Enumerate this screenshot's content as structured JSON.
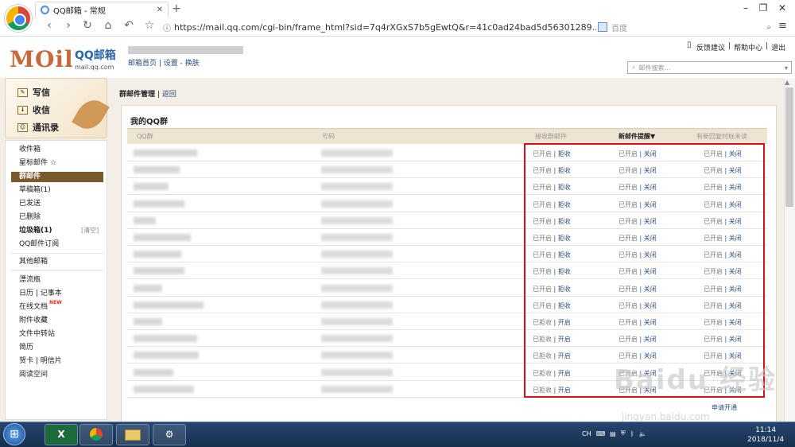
{
  "browser": {
    "tab_title": "QQ邮箱 - 常规",
    "new_tab": "+",
    "url": "https://mail.qq.com/cgi-bin/frame_html?sid=7q4rXGxS7b5gEwtQ&r=41c0ad24bad5d56301289...",
    "search_placeholder": "百度",
    "window_controls": [
      "–",
      "❐",
      "✕"
    ]
  },
  "header": {
    "logo_mark": "MOil",
    "logo_name": "QQ邮箱",
    "logo_domain": "mail.qq.com",
    "links": "邮箱首页 | 设置 - 换肤",
    "top_links": [
      "反馈建议",
      "|",
      "帮助中心",
      "|",
      "退出"
    ],
    "search_placeholder": "邮件搜索..."
  },
  "sidebar": {
    "actions": [
      "写信",
      "收信",
      "通讯录"
    ],
    "items": [
      {
        "label": "收件箱"
      },
      {
        "label": "星标邮件 ☆"
      },
      {
        "label": "群邮件"
      },
      {
        "label": "草稿箱(1)"
      },
      {
        "label": "已发送"
      },
      {
        "label": "已删除"
      },
      {
        "label": "垃圾箱(1)"
      },
      {
        "label": "QQ邮件订阅"
      },
      {
        "label": "其他邮箱"
      },
      {
        "label": "漂流瓶"
      },
      {
        "label": "日历 | 记事本"
      },
      {
        "label": "在线文档"
      },
      {
        "label": "附件收藏"
      },
      {
        "label": "文件中转站"
      },
      {
        "label": "简历"
      },
      {
        "label": "贺卡 | 明信片"
      },
      {
        "label": "阅读空间"
      }
    ],
    "trash_clear": "[清空]",
    "new_badge": "NEW"
  },
  "breadcrumb": {
    "title": "群邮件管理",
    "sep": "|",
    "back": "返回"
  },
  "panel": {
    "title": "我的QQ群",
    "columns": [
      "QQ群",
      "号码",
      "接收群邮件",
      "新邮件提醒▼",
      "有新回复时标未读"
    ],
    "rows": [
      {
        "receive": [
          "已开启",
          "拒收"
        ],
        "notify": [
          "已开启",
          "关闭"
        ],
        "unread": [
          "已开启",
          "关闭"
        ]
      },
      {
        "receive": [
          "已开启",
          "拒收"
        ],
        "notify": [
          "已开启",
          "关闭"
        ],
        "unread": [
          "已开启",
          "关闭"
        ]
      },
      {
        "receive": [
          "已开启",
          "拒收"
        ],
        "notify": [
          "已开启",
          "关闭"
        ],
        "unread": [
          "已开启",
          "关闭"
        ]
      },
      {
        "receive": [
          "已开启",
          "拒收"
        ],
        "notify": [
          "已开启",
          "关闭"
        ],
        "unread": [
          "已开启",
          "关闭"
        ]
      },
      {
        "receive": [
          "已开启",
          "拒收"
        ],
        "notify": [
          "已开启",
          "关闭"
        ],
        "unread": [
          "已开启",
          "关闭"
        ]
      },
      {
        "receive": [
          "已开启",
          "拒收"
        ],
        "notify": [
          "已开启",
          "关闭"
        ],
        "unread": [
          "已开启",
          "关闭"
        ]
      },
      {
        "receive": [
          "已开启",
          "拒收"
        ],
        "notify": [
          "已开启",
          "关闭"
        ],
        "unread": [
          "已开启",
          "关闭"
        ]
      },
      {
        "receive": [
          "已开启",
          "拒收"
        ],
        "notify": [
          "已开启",
          "关闭"
        ],
        "unread": [
          "已开启",
          "关闭"
        ]
      },
      {
        "receive": [
          "已开启",
          "拒收"
        ],
        "notify": [
          "已开启",
          "关闭"
        ],
        "unread": [
          "已开启",
          "关闭"
        ]
      },
      {
        "receive": [
          "已开启",
          "拒收"
        ],
        "notify": [
          "已开启",
          "关闭"
        ],
        "unread": [
          "已开启",
          "关闭"
        ]
      },
      {
        "receive": [
          "已拒收",
          "开启"
        ],
        "notify": [
          "已开启",
          "关闭"
        ],
        "unread": [
          "已开启",
          "关闭"
        ]
      },
      {
        "receive": [
          "已拒收",
          "开启"
        ],
        "notify": [
          "已开启",
          "关闭"
        ],
        "unread": [
          "已开启",
          "关闭"
        ]
      },
      {
        "receive": [
          "已拒收",
          "开启"
        ],
        "notify": [
          "已开启",
          "关闭"
        ],
        "unread": [
          "已开启",
          "关闭"
        ]
      },
      {
        "receive": [
          "已拒收",
          "开启"
        ],
        "notify": [
          "已开启",
          "关闭"
        ],
        "unread": [
          "已开启",
          "关闭"
        ]
      },
      {
        "receive": [
          "已拒收",
          "开启"
        ],
        "notify": [
          "已开启",
          "关闭"
        ],
        "unread": [
          "已开启",
          "关闭"
        ]
      }
    ],
    "apply_link": "申请开通"
  },
  "taskbar": {
    "apps": [
      "X",
      "",
      "",
      ""
    ],
    "tray": "CH",
    "time": "11:14",
    "date": "2018/11/4"
  },
  "watermark": {
    "text": "Baidu 经验",
    "url": "jingyan.baidu.com"
  },
  "colors": {
    "accent": "#7a5a2d",
    "highlight": "#d80f18",
    "link": "#2d4f7e"
  }
}
